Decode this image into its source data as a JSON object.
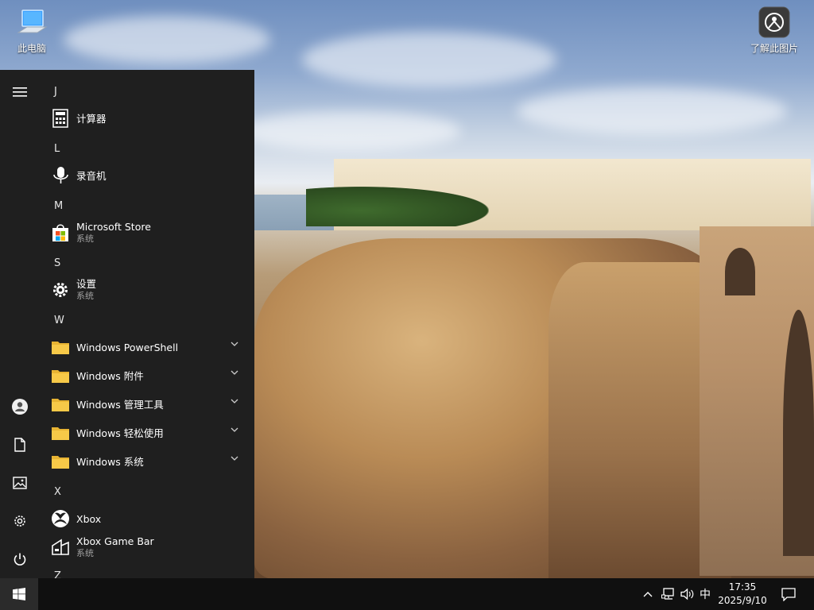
{
  "desktop": {
    "icons": [
      {
        "label": "此电脑",
        "icon": "computer-icon"
      },
      {
        "label": "了解此图片",
        "icon": "camera-info-icon"
      }
    ]
  },
  "start_menu": {
    "rail": [
      {
        "icon": "hamburger-icon"
      },
      {
        "icon": "user-account-icon"
      },
      {
        "icon": "documents-icon"
      },
      {
        "icon": "pictures-icon"
      },
      {
        "icon": "settings-gear-icon"
      },
      {
        "icon": "power-icon"
      }
    ],
    "letters": {
      "J": "J",
      "L": "L",
      "M": "M",
      "S": "S",
      "W": "W",
      "X": "X",
      "Z": "Z"
    },
    "apps": {
      "calculator": {
        "name": "计算器",
        "icon": "calculator-icon"
      },
      "recorder": {
        "name": "录音机",
        "icon": "microphone-icon"
      },
      "store": {
        "name": "Microsoft Store",
        "sub": "系统",
        "icon": "store-icon"
      },
      "settings": {
        "name": "设置",
        "sub": "系统",
        "icon": "gear-icon"
      },
      "powershell": {
        "name": "Windows PowerShell",
        "icon": "folder-icon"
      },
      "accessories": {
        "name": "Windows 附件",
        "icon": "folder-icon"
      },
      "admin_tools": {
        "name": "Windows 管理工具",
        "icon": "folder-icon"
      },
      "ease_of_access": {
        "name": "Windows 轻松使用",
        "icon": "folder-icon"
      },
      "system": {
        "name": "Windows 系统",
        "icon": "folder-icon"
      },
      "xbox": {
        "name": "Xbox",
        "icon": "xbox-icon"
      },
      "xbox_game_bar": {
        "name": "Xbox Game Bar",
        "sub": "系统",
        "icon": "xbox-game-bar-icon"
      }
    }
  },
  "taskbar": {
    "start_icon": "windows-logo-icon",
    "tray": {
      "ime": "中",
      "time": "17:35",
      "date": "2025/9/10"
    },
    "colors": {
      "taskbar": "#101010",
      "start_menu": "#1f1f1f",
      "accent_folder": "#f7c948"
    }
  }
}
